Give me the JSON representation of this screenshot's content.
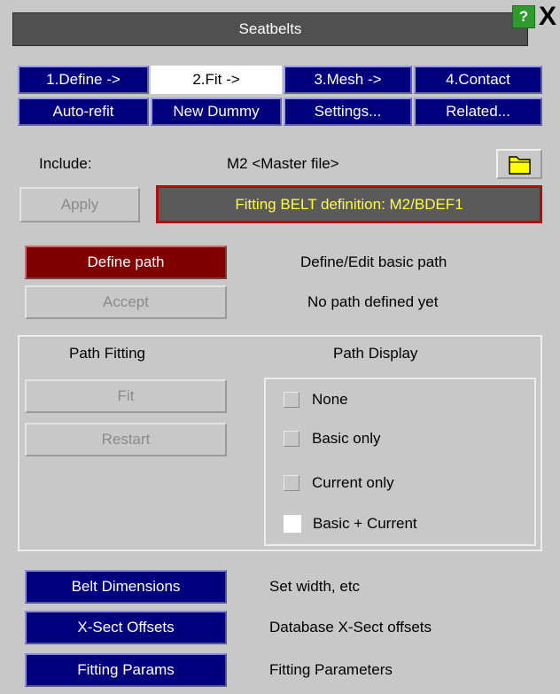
{
  "window": {
    "title": "Seatbelts",
    "help_label": "?",
    "close_label": "X"
  },
  "tabs_row1": [
    {
      "label": "1.Define ->",
      "active": false
    },
    {
      "label": "2.Fit ->",
      "active": true
    },
    {
      "label": "3.Mesh ->",
      "active": false
    },
    {
      "label": "4.Contact",
      "active": false
    }
  ],
  "tabs_row2": [
    {
      "label": "Auto-refit"
    },
    {
      "label": "New Dummy"
    },
    {
      "label": "Settings..."
    },
    {
      "label": "Related..."
    }
  ],
  "include": {
    "label": "Include:",
    "value": "M2  <Master file>",
    "folder_icon": "folder-icon"
  },
  "apply_label": "Apply",
  "status_banner": "Fitting BELT definition: M2/BDEF1",
  "define_path": {
    "button_label": "Define path",
    "description": "Define/Edit basic path"
  },
  "accept": {
    "button_label": "Accept",
    "description": "No path defined yet"
  },
  "path_fitting": {
    "heading": "Path Fitting",
    "fit_label": "Fit",
    "restart_label": "Restart"
  },
  "path_display": {
    "heading": "Path Display",
    "options": [
      {
        "label": "None",
        "checked": false
      },
      {
        "label": "Basic only",
        "checked": false
      },
      {
        "label": "Current only",
        "checked": false
      },
      {
        "label": "Basic + Current",
        "checked": true
      }
    ]
  },
  "bottom_actions": [
    {
      "button_label": "Belt Dimensions",
      "description": "Set width, etc"
    },
    {
      "button_label": "X-Sect Offsets",
      "description": "Database X-Sect offsets"
    },
    {
      "button_label": "Fitting Params",
      "description": "Fitting Parameters"
    }
  ],
  "colors": {
    "background": "#c8c8c8",
    "blue_button": "#00007f",
    "red_button": "#800000",
    "banner_text": "#ffff40",
    "banner_border": "#aa1010",
    "help_green": "#2f9b2f"
  }
}
